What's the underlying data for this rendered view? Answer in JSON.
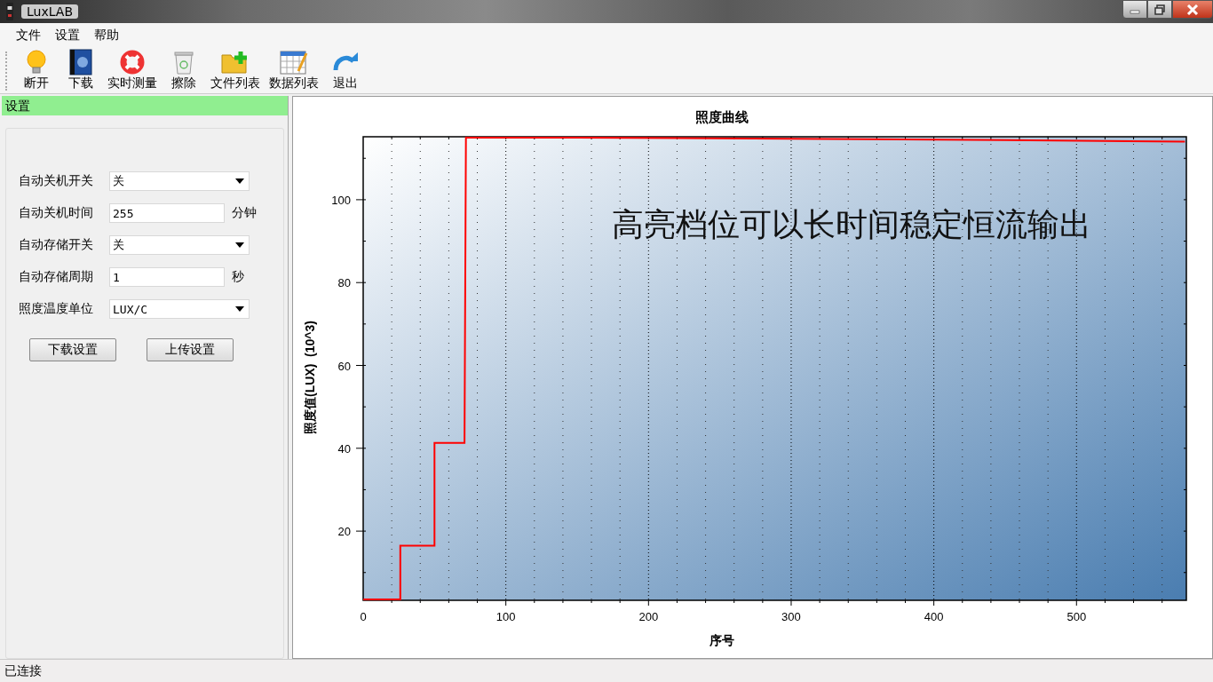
{
  "window": {
    "title": "LuxLAB"
  },
  "menu": [
    "文件",
    "设置",
    "帮助"
  ],
  "toolbar": [
    {
      "kind": "bulb",
      "label": "断开"
    },
    {
      "kind": "book",
      "label": "下载"
    },
    {
      "kind": "lifebuoy",
      "label": "实时测量"
    },
    {
      "kind": "bin",
      "label": "擦除"
    },
    {
      "kind": "folder",
      "label": "文件列表"
    },
    {
      "kind": "table",
      "label": "数据列表"
    },
    {
      "kind": "arrow",
      "label": "退出"
    }
  ],
  "settings_panel": {
    "title": "设置",
    "fields": [
      {
        "kind": "select",
        "label": "自动关机开关",
        "value": "关"
      },
      {
        "kind": "input",
        "label": "自动关机时间",
        "value": "255",
        "unit": "分钟"
      },
      {
        "kind": "select",
        "label": "自动存储开关",
        "value": "关"
      },
      {
        "kind": "input",
        "label": "自动存储周期",
        "value": "1",
        "unit": "秒"
      },
      {
        "kind": "select",
        "label": "照度温度单位",
        "value": "LUX/C"
      }
    ],
    "buttons": [
      "下载设置",
      "上传设置"
    ]
  },
  "chart": {
    "chart_data": {
      "type": "line",
      "title": "照度曲线",
      "xlabel": "序号",
      "ylabel": "照度值(LUX)  (10^3)",
      "x": [
        0,
        26,
        26,
        50,
        50,
        71,
        72,
        150,
        300,
        450,
        576
      ],
      "grid": true,
      "series": [
        {
          "color": "#ff0000",
          "values": [
            3.5,
            3.5,
            16.5,
            16.5,
            41.3,
            41.3,
            115,
            115,
            114.7,
            114.4,
            114
          ]
        }
      ],
      "xlim": [
        0,
        577
      ],
      "ylim": [
        3.3,
        115.2
      ],
      "xticks": [
        0,
        100,
        200,
        300,
        400,
        500
      ],
      "yticks": [
        20,
        40,
        60,
        80,
        100
      ],
      "annotations": [
        {
          "text": "高亮档位可以长时间稳定恒流输出"
        }
      ]
    }
  },
  "status_bar": "已连接"
}
